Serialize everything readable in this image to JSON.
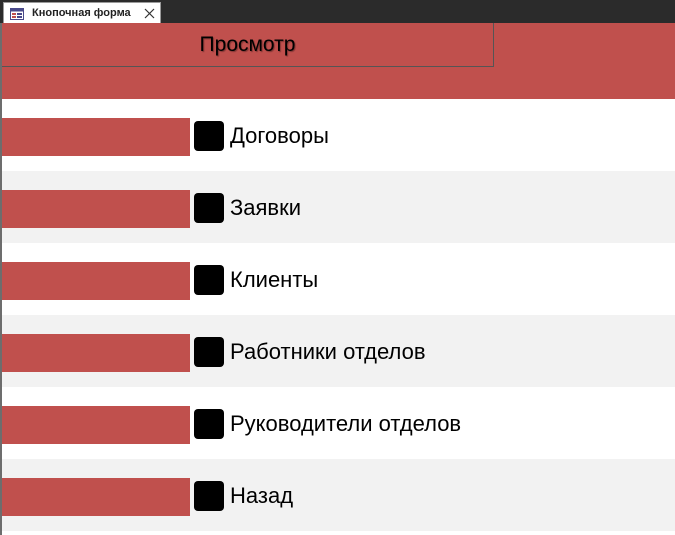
{
  "tab": {
    "title": "Кнопочная форма",
    "icon": "form-icon",
    "close_icon": "close-icon"
  },
  "colors": {
    "accent": "#c0504d",
    "row_alt": "#f2f2f2",
    "button": "#000000"
  },
  "header": {
    "title": "Просмотр"
  },
  "menu": {
    "items": [
      {
        "label": "Договоры"
      },
      {
        "label": "Заявки"
      },
      {
        "label": "Клиенты"
      },
      {
        "label": "Работники отделов"
      },
      {
        "label": "Руководители отделов"
      },
      {
        "label": "Назад"
      }
    ]
  }
}
